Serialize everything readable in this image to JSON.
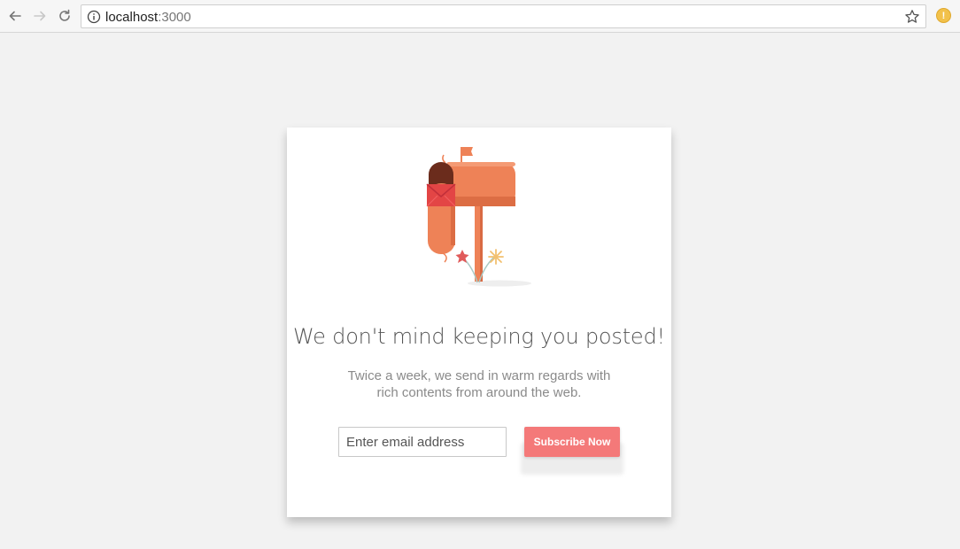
{
  "browser": {
    "url_host": "localhost",
    "url_port": ":3000",
    "ext_badge": "!"
  },
  "card": {
    "headline": "We don't mind keeping you posted!",
    "subtext_line1": "Twice a week, we send in warm regards with",
    "subtext_line2": "rich contents from around the web.",
    "email_placeholder": "Enter email address",
    "subscribe_label": "Subscribe Now"
  },
  "colors": {
    "accent": "#f47979",
    "mailbox": "#ee8257",
    "mailbox_dark": "#6b2c1c",
    "envelope": "#e34545",
    "background": "#f2f2f2"
  },
  "icons": [
    "back-arrow-icon",
    "forward-arrow-icon",
    "reload-icon",
    "info-icon",
    "star-icon",
    "extension-icon",
    "mailbox-icon"
  ]
}
